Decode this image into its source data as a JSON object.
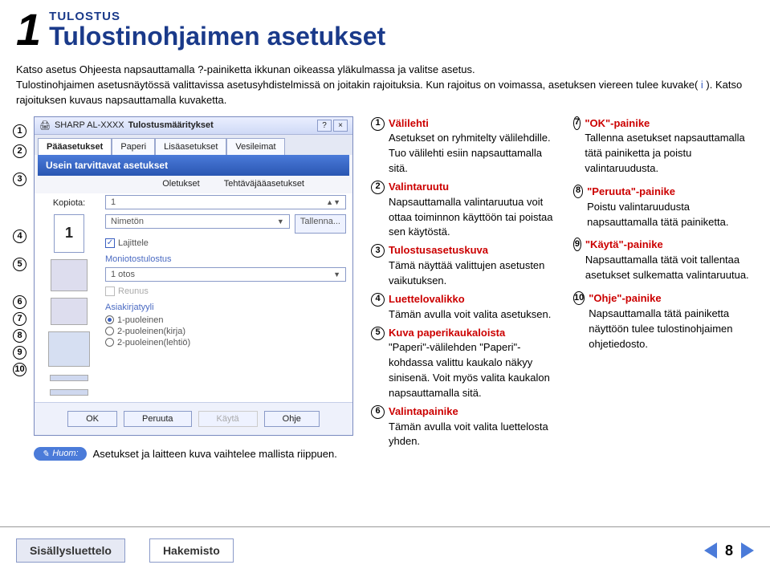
{
  "header": {
    "chapter_number": "1",
    "kicker": "TULOSTUS",
    "title": "Tulostinohjaimen asetukset"
  },
  "intro": {
    "line1_a": "Katso asetus Ohjeesta napsauttamalla ",
    "line1_b": "-painiketta ikkunan oikeassa yläkulmassa ja valitse asetus.",
    "line2": "Tulostinohjaimen asetusnäytössä valittavissa asetusyhdistelmissä on joitakin rajoituksia. Kun rajoitus on voimassa, asetuksen viereen tulee kuvake( ",
    "line2_b": " ). Katso rajoituksen kuvaus napsauttamalla kuvaketta."
  },
  "dialog": {
    "app": "SHARP AL-XXXX",
    "title": "Tulostusmääritykset",
    "tabs": [
      "Pääasetukset",
      "Paperi",
      "Lisäasetukset",
      "Vesileimat"
    ],
    "banner": "Usein tarvittavat asetukset",
    "strip_left": "Oletukset",
    "strip_right": "Tehtäväjääasetukset",
    "copies_label": "Kopiota:",
    "copies_value": "1",
    "drop1": "Nimetön",
    "save_btn": "Tallenna...",
    "chk_lajittele": "Lajittele",
    "sect_mono": "Moniotostulostus",
    "drop_mono": "1 otos",
    "chk_reunus": "Reunus",
    "sect_asia": "Asiakirjatyyli",
    "radio1": "1-puoleinen",
    "radio2": "2-puoleinen(kirja)",
    "radio3": "2-puoleinen(lehtiö)",
    "btn_ok": "OK",
    "btn_cancel": "Peruuta",
    "btn_apply": "Käytä",
    "btn_help": "Ohje"
  },
  "callout_numbers": [
    "1",
    "2",
    "3",
    "4",
    "5",
    "6",
    "7",
    "8",
    "9",
    "10"
  ],
  "note": {
    "badge": "Huom:",
    "text": "Asetukset ja laitteen kuva vaihtelee mallista riippuen."
  },
  "explanations_mid": [
    {
      "num": "1",
      "head": "Välilehti",
      "body": "Asetukset on ryhmitelty välilehdille. Tuo välilehti esiin napsauttamalla sitä."
    },
    {
      "num": "2",
      "head": "Valintaruutu",
      "body": "Napsauttamalla valintaruutua voit ottaa toiminnon käyttöön tai poistaa sen käytöstä."
    },
    {
      "num": "3",
      "head": "Tulostusasetuskuva",
      "body": "Tämä näyttää valittujen asetusten vaikutuksen."
    },
    {
      "num": "4",
      "head": "Luettelovalikko",
      "body": "Tämän avulla voit valita asetuksen."
    },
    {
      "num": "5",
      "head": "Kuva paperikaukaloista",
      "body": "\"Paperi\"-välilehden \"Paperi\"-kohdassa valittu kaukalo näkyy sinisenä. Voit myös valita kaukalon napsauttamalla sitä."
    },
    {
      "num": "6",
      "head": "Valintapainike",
      "body": "Tämän avulla voit valita luettelosta yhden."
    }
  ],
  "explanations_right": [
    {
      "num": "7",
      "head": "\"OK\"-painike",
      "body": "Tallenna asetukset napsauttamalla tätä painiketta ja poistu valintaruudusta."
    },
    {
      "num": "8",
      "head": "\"Peruuta\"-painike",
      "body": "Poistu valintaruudusta napsauttamalla tätä painiketta."
    },
    {
      "num": "9",
      "head": "\"Käytä\"-painike",
      "body": "Napsauttamalla tätä voit tallentaa asetukset sulkematta valintaruutua."
    },
    {
      "num": "10",
      "head": "\"Ohje\"-painike",
      "body": "Napsauttamalla tätä painiketta näyttöön tulee tulostinohjaimen ohjetiedosto."
    }
  ],
  "footer": {
    "toc": "Sisällysluettelo",
    "index": "Hakemisto",
    "page": "8"
  }
}
